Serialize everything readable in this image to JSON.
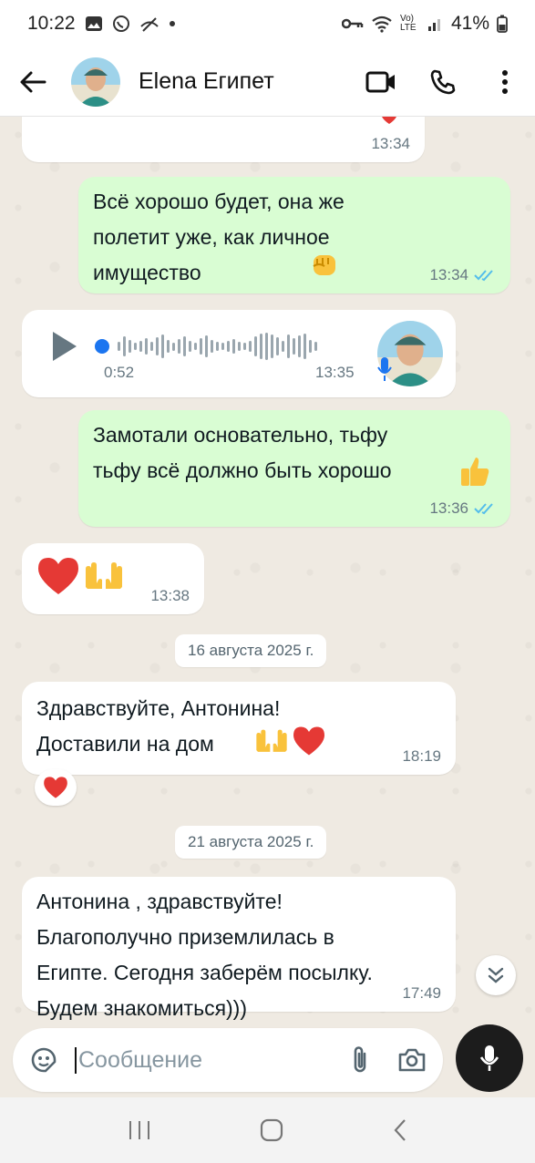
{
  "status_bar": {
    "time": "10:22",
    "battery": "41%",
    "network_label": "Vo) LTE"
  },
  "header": {
    "contact_name": "Elena Египет"
  },
  "messages": {
    "m0_time": "13:34",
    "m1_text": "Всё  хорошо будет,  она же\nполетит уже,  как личное\nимущество",
    "m1_time": "13:34",
    "voice_duration": "0:52",
    "voice_time": "13:35",
    "m3_text": "Замотали основательно, тьфу\nтьфу всё  должно быть хорошо",
    "m3_time": "13:36",
    "m4_time": "13:38",
    "date1": "16 августа 2025 г.",
    "m5_text": "Здравствуйте,  Антонина!\nДоставили на дом",
    "m5_time": "18:19",
    "date2": "21 августа 2025 г.",
    "m6_text": "Антонина  , здравствуйте!\nБлагополучно приземлилась в\nЕгипте. Сегодня заберём посылку.\nБудем знакомиться)))",
    "m6_time": "17:49"
  },
  "input": {
    "placeholder": "Сообщение"
  },
  "colors": {
    "outgoing_bubble": "#d9fdd3",
    "incoming_bubble": "#ffffff",
    "read_ticks": "#53bdeb",
    "chat_bg": "#efeae2"
  },
  "icons": {
    "back": "arrow-left-icon",
    "video": "video-camera-icon",
    "call": "phone-icon",
    "menu": "more-vertical-icon",
    "sticker": "sticker-icon",
    "attach": "paperclip-icon",
    "camera": "camera-icon",
    "mic": "microphone-icon"
  }
}
